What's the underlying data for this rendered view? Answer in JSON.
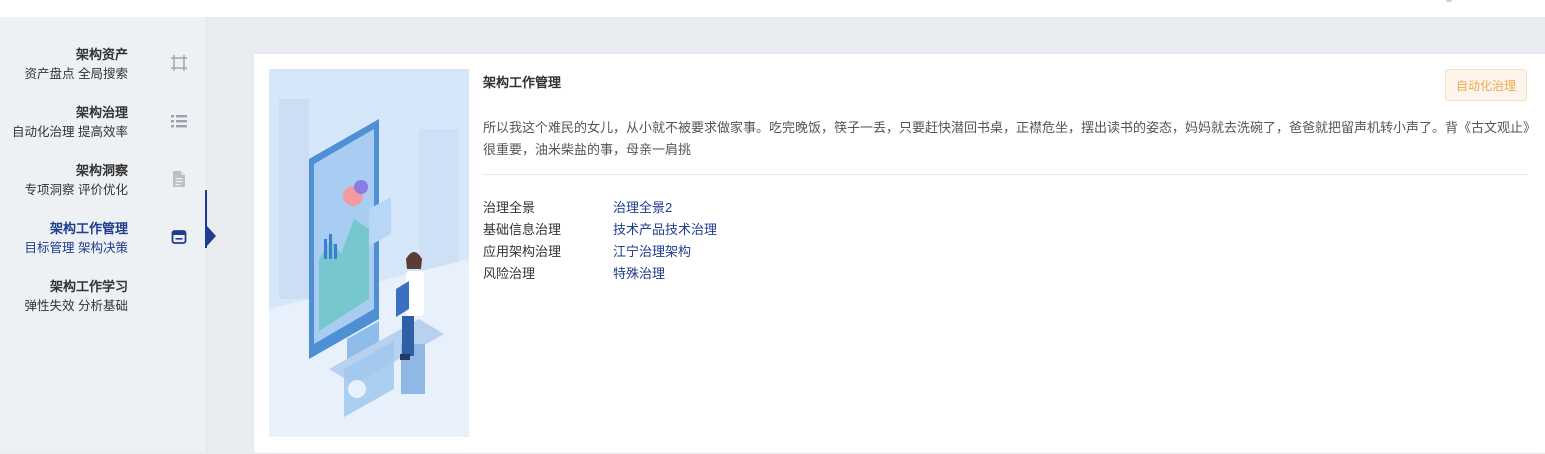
{
  "sidebar": {
    "items": [
      {
        "title": "架构资产",
        "subtitle": "资产盘点 全局搜索",
        "icon": "crop-frame-icon",
        "active": false
      },
      {
        "title": "架构治理",
        "subtitle": "自动化治理 提高效率",
        "icon": "list-icon",
        "active": false
      },
      {
        "title": "架构洞察",
        "subtitle": "专项洞察 评价优化",
        "icon": "document-icon",
        "active": false
      },
      {
        "title": "架构工作管理",
        "subtitle": "目标管理 架构决策",
        "icon": "calendar-icon",
        "active": true
      },
      {
        "title": "架构工作学习",
        "subtitle": "弹性失效 分析基础",
        "icon": "",
        "active": false
      }
    ]
  },
  "card": {
    "title": "架构工作管理",
    "tag": "自动化治理",
    "description": "所以我这个难民的女儿，从小就不被要求做家事。吃完晚饭，筷子一丢，只要赶快潜回书桌，正襟危坐，摆出读书的姿态，妈妈就去洗碗了，爸爸就把留声机转小声了。背《古文观止》很重要，油米柴盐的事，母亲一肩挑",
    "rows": [
      {
        "label": "治理全景",
        "value": "治理全景2"
      },
      {
        "label": "基础信息治理",
        "value": "技术产品技术治理"
      },
      {
        "label": "应用架构治理",
        "value": "江宁治理架构"
      },
      {
        "label": "风险治理",
        "value": "特殊治理"
      }
    ]
  },
  "colors": {
    "accent": "#1e3d8f",
    "tag_text": "#f0a84e",
    "tag_bg": "#fdf5ec",
    "background": "#e8ecf0"
  }
}
